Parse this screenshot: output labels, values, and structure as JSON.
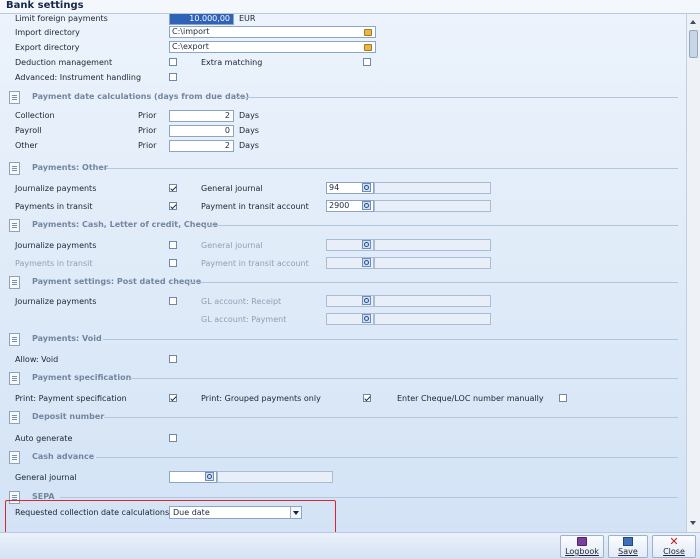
{
  "window": {
    "title": "Bank settings"
  },
  "general": {
    "limit_foreign_label": "Limit foreign payments",
    "limit_foreign_value": "10.000,00",
    "limit_foreign_currency": "EUR",
    "import_dir_label": "Import directory",
    "import_dir_value": "C:\\import",
    "export_dir_label": "Export directory",
    "export_dir_value": "C:\\export",
    "deduction_label": "Deduction management",
    "extra_matching_label": "Extra matching",
    "advanced_label": "Advanced: Instrument handling"
  },
  "payment_date": {
    "title": "Payment date calculations (days from due date)",
    "prior_label": "Prior",
    "days_label": "Days",
    "rows": [
      {
        "label": "Collection",
        "value": "2"
      },
      {
        "label": "Payroll",
        "value": "0"
      },
      {
        "label": "Other",
        "value": "2"
      }
    ]
  },
  "payments_other": {
    "title": "Payments: Other",
    "journalize_label": "Journalize payments",
    "in_transit_label": "Payments in transit",
    "general_journal_label": "General journal",
    "general_journal_value": "94",
    "transit_account_label": "Payment in transit account",
    "transit_account_value": "2900"
  },
  "payments_cash": {
    "title": "Payments: Cash, Letter of credit, Cheque",
    "journalize_label": "Journalize payments",
    "in_transit_label": "Payments in transit",
    "general_journal_label": "General journal",
    "transit_account_label": "Payment in transit account"
  },
  "post_dated": {
    "title": "Payment settings: Post dated cheque",
    "journalize_label": "Journalize payments",
    "gl_receipt_label": "GL account: Receipt",
    "gl_payment_label": "GL account: Payment"
  },
  "payments_void": {
    "title": "Payments: Void",
    "allow_void_label": "Allow: Void"
  },
  "payment_spec": {
    "title": "Payment specification",
    "print_spec_label": "Print: Payment specification",
    "print_grouped_label": "Print: Grouped payments only",
    "enter_cheque_label": "Enter Cheque/LOC number manually"
  },
  "deposit": {
    "title": "Deposit number",
    "auto_generate_label": "Auto generate"
  },
  "cash_advance": {
    "title": "Cash advance",
    "general_journal_label": "General journal"
  },
  "sepa": {
    "title": "SEPA",
    "requested_label": "Requested collection date calculations",
    "requested_value": "Due date"
  },
  "footer": {
    "logbook_label": "Logbook",
    "save_label": "Save",
    "close_label": "Close"
  },
  "colors": {
    "highlight": "#d9272d",
    "selection": "#2f63b8",
    "background": "#d6e4f5"
  }
}
